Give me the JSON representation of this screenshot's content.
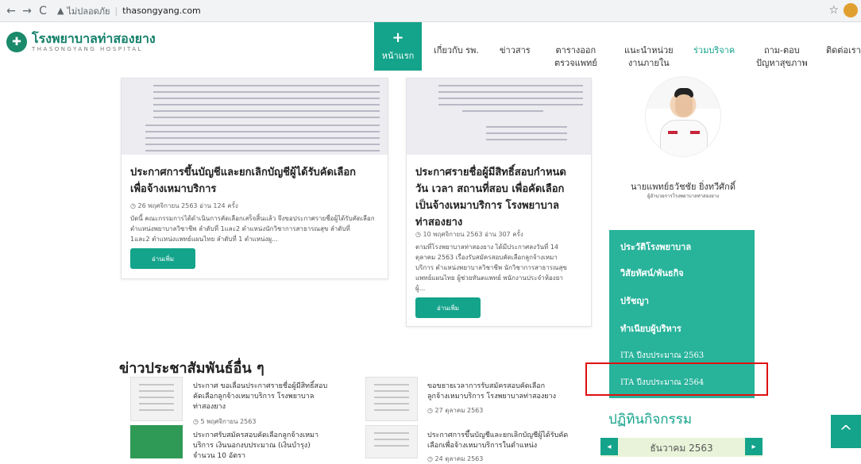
{
  "browser": {
    "back": "←",
    "forward": "→",
    "reload": "C",
    "security": "ไม่ปลอดภัย",
    "url": "thasongyang.com",
    "star": "☆"
  },
  "site": {
    "logo_th": "โรงพยาบาลท่าสองยาง",
    "logo_en": "THASONGYANG HOSPITAL"
  },
  "menu": {
    "home_icon": "+",
    "home": "หน้าแรก",
    "about": "เกี่ยวกับ รพ.",
    "news": "ข่าวสาร",
    "schedule_1": "ตารางออก",
    "schedule_2": "ตรวจแพทย์",
    "units_1": "แนะนำหน่วย",
    "units_2": "งานภายใน",
    "donate": "ร่วมบริจาค",
    "qa_1": "ถาม-ตอบ",
    "qa_2": "ปัญหาสุขภาพ",
    "contact": "ติดต่อเรา"
  },
  "posts": [
    {
      "title_1": "ประกาศการขึ้นบัญชีและยกเลิกบัญชีผู้ได้รับคัดเลือก",
      "title_2": "เพื่อจ้างเหมาบริการ",
      "meta": "◷ 26 พฤศจิกายน 2563 อ่าน 124 ครั้ง",
      "excerpt_1": "บัดนี้ คณะกรรมการได้ดำเนินการคัดเลือกเสร็จสิ้นแล้ว จึงขอประกาศรายชื่อผู้ได้รับคัดเลือก",
      "excerpt_2": "ตำแหน่งพยาบาลวิชาชีพ ลำดับที่ 1และ2 ตำแหน่งนักวิชาการสาธารณสุข ลำดับที่",
      "excerpt_3": "1และ2 ตำแหน่งแพทย์แผนไทย ลำดับที่ 1 ตำแหน่งผู...",
      "button": "อ่านเพิ่ม"
    },
    {
      "title_1": "ประกาศรายชื่อผู้มีสิทธิ์สอบกำหนด",
      "title_2": "วัน เวลา สถานที่สอบ เพื่อคัดเลือก",
      "title_3": "เป็นจ้างเหมาบริการ โรงพยาบาล",
      "title_4": "ท่าสองยาง",
      "meta": "◷ 10 พฤศจิกายน 2563 อ่าน 307 ครั้ง",
      "excerpt_1": "ตามที่โรงพยาบาลท่าสองยาง ได้มีประกาศลงวันที่ 14",
      "excerpt_2": "ตุลาคม 2563 เรื่องรับสมัครสอบคัดเลือกลูกจ้างเหมา",
      "excerpt_3": "บริการ ตำแหน่งพยาบาลวิชาชีพ นักวิชาการสาธารณสุข",
      "excerpt_4": "แพทย์แผนไทย ผู้ช่วยทันตแพทย์ พนักงานประจำห้องยา",
      "excerpt_5": "ผู้...",
      "button": "อ่านเพิ่ม"
    }
  ],
  "director": {
    "name": "นายแพทย์ธวัชชัย ยิ่งทวีศักดิ์",
    "title": "ผู้อำนวยการโรงพยาบาลท่าสองยาง"
  },
  "side_menu": [
    "ประวัติโรงพยาบาล",
    "วิสัยทัศน์/พันธกิจ",
    "ปรัชญา",
    "ทำเนียบผู้บริหาร",
    "ITA ปีงบประมาณ 2563",
    "ITA ปีงบประมาณ 2564"
  ],
  "activities": {
    "heading": "ปฏิทินกิจกรรม",
    "month": "ธันวาคม 2563",
    "prev": "◂",
    "next": "▸"
  },
  "other_news": {
    "heading": "ข่าวประชาสัมพันธ์อื่น ๆ",
    "items": [
      {
        "line_1": "ประกาศ ขอเลื่อนประกาศรายชื่อผู้มีสิทธิ์สอบ",
        "line_2": "คัดเลือกลูกจ้างเหมาบริการ โรงพยาบาล",
        "line_3": "ท่าสองยาง",
        "date": "◷ 5 พฤศจิกายน 2563"
      },
      {
        "line_1": "ขอขยายเวลาการรับสมัครสอบคัดเลือก",
        "line_2": "ลูกจ้างเหมาบริการ โรงพยาบาลท่าสองยาง",
        "date": "◷ 27 ตุลาคม 2563"
      },
      {
        "line_1": "ประกาศรับสมัครสอบคัดเลือกลูกจ้างเหมา",
        "line_2": "บริการ เงินนอกงบประมาณ (เงินบำรุง)",
        "line_3": "จำนวน 10 อัตรา"
      },
      {
        "line_1": "ประกาศการขึ้นบัญชีและยกเลิกบัญชีผู้ได้รับคัด",
        "line_2": "เลือกเพื่อจ้างเหมาบริการในตำแหน่ง",
        "date": "◷ 24 ตุลาคม 2563"
      }
    ]
  },
  "scroll_top": "^"
}
